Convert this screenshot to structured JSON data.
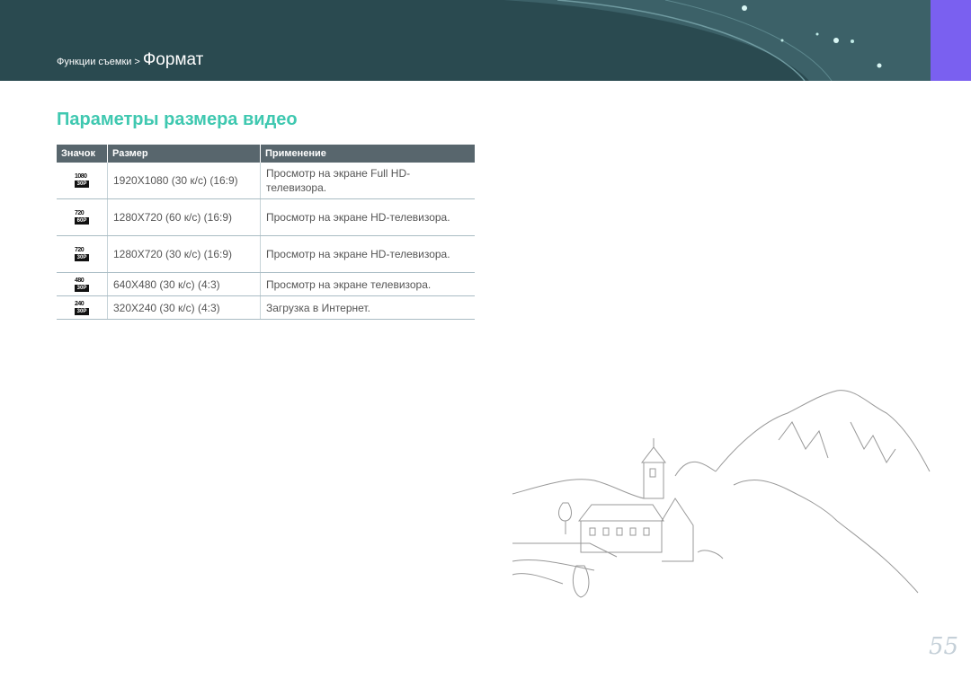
{
  "header": {
    "breadcrumb_section": "Функции съемки",
    "breadcrumb_separator": ">",
    "breadcrumb_current": "Формат",
    "background_color": "#2a4a50",
    "tab_color": "#7a60f0"
  },
  "page": {
    "title": "Параметры размера видео",
    "title_color": "#3fc8b0",
    "page_number": "55"
  },
  "table": {
    "headers": [
      "Значок",
      "Размер",
      "Применение"
    ],
    "rows": [
      {
        "icon_top": "1080",
        "icon_bottom": "30P",
        "size": "1920X1080 (30 к/с) (16:9)",
        "usage": "Просмотр на экране Full HD-телевизора."
      },
      {
        "icon_top": "720",
        "icon_bottom": "60P",
        "size": "1280X720 (60 к/с) (16:9)",
        "usage": "Просмотр на экране HD-телевизора."
      },
      {
        "icon_top": "720",
        "icon_bottom": "30P",
        "size": "1280X720 (30 к/с) (16:9)",
        "usage": "Просмотр на экране HD-телевизора."
      },
      {
        "icon_top": "480",
        "icon_bottom": "30P",
        "size": "640X480 (30 к/с) (4:3)",
        "usage": "Просмотр на экране телевизора."
      },
      {
        "icon_top": "240",
        "icon_bottom": "30P",
        "size": "320X240 (30 к/с) (4:3)",
        "usage": "Загрузка в Интернет."
      }
    ]
  }
}
